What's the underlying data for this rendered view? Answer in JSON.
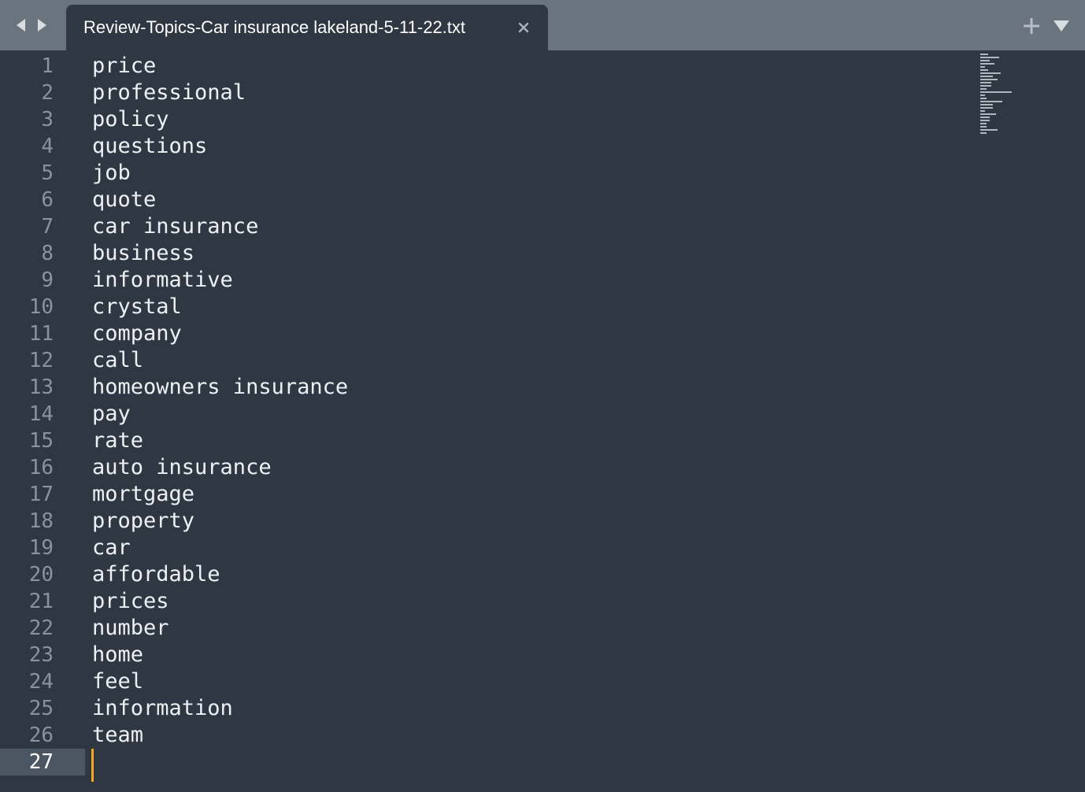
{
  "tab": {
    "title": "Review-Topics-Car insurance lakeland-5-11-22.txt"
  },
  "icons": {
    "back": "chevron-left-icon",
    "forward": "chevron-right-icon",
    "close": "close-icon",
    "new_tab": "plus-icon",
    "tab_menu": "triangle-down-icon"
  },
  "colors": {
    "tabbar_bg": "#6a747e",
    "editor_bg": "#2f3842",
    "text": "#eef1f4",
    "line_number": "#8a929b",
    "current_line_gutter": "#4b5663",
    "cursor": "#f5a623"
  },
  "editor": {
    "current_line": 27,
    "lines": [
      {
        "num": "1",
        "text": "price"
      },
      {
        "num": "2",
        "text": "professional"
      },
      {
        "num": "3",
        "text": "policy"
      },
      {
        "num": "4",
        "text": "questions"
      },
      {
        "num": "5",
        "text": "job"
      },
      {
        "num": "6",
        "text": "quote"
      },
      {
        "num": "7",
        "text": "car insurance"
      },
      {
        "num": "8",
        "text": "business"
      },
      {
        "num": "9",
        "text": "informative"
      },
      {
        "num": "10",
        "text": "crystal"
      },
      {
        "num": "11",
        "text": "company"
      },
      {
        "num": "12",
        "text": "call"
      },
      {
        "num": "13",
        "text": "homeowners insurance"
      },
      {
        "num": "14",
        "text": "pay"
      },
      {
        "num": "15",
        "text": "rate"
      },
      {
        "num": "16",
        "text": "auto insurance"
      },
      {
        "num": "17",
        "text": "mortgage"
      },
      {
        "num": "18",
        "text": "property"
      },
      {
        "num": "19",
        "text": "car"
      },
      {
        "num": "20",
        "text": "affordable"
      },
      {
        "num": "21",
        "text": "prices"
      },
      {
        "num": "22",
        "text": "number"
      },
      {
        "num": "23",
        "text": "home"
      },
      {
        "num": "24",
        "text": "feel"
      },
      {
        "num": "25",
        "text": "information"
      },
      {
        "num": "26",
        "text": "team"
      },
      {
        "num": "27",
        "text": ""
      }
    ]
  }
}
